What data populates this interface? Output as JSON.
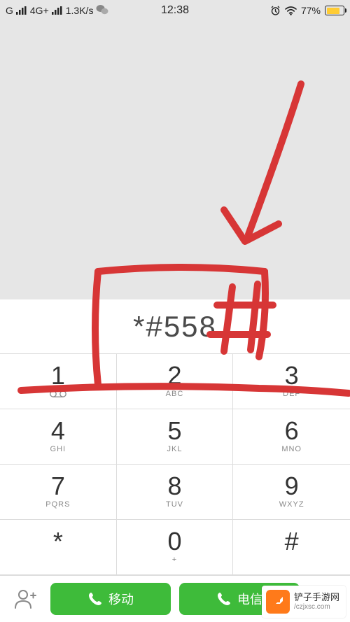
{
  "status_bar": {
    "net_label": "G",
    "net_gen": "4G+",
    "data_rate": "1.3K/s",
    "time": "12:38",
    "battery_pct": "77%",
    "battery_fill": 77
  },
  "dialer": {
    "entered_number": "*#558",
    "keys": [
      {
        "digit": "1",
        "letters": "",
        "voicemail": true
      },
      {
        "digit": "2",
        "letters": "ABC"
      },
      {
        "digit": "3",
        "letters": "DEF"
      },
      {
        "digit": "4",
        "letters": "GHI"
      },
      {
        "digit": "5",
        "letters": "JKL"
      },
      {
        "digit": "6",
        "letters": "MNO"
      },
      {
        "digit": "7",
        "letters": "PQRS"
      },
      {
        "digit": "8",
        "letters": "TUV"
      },
      {
        "digit": "9",
        "letters": "WXYZ"
      },
      {
        "digit": "*",
        "letters": ""
      },
      {
        "digit": "0",
        "letters": "+"
      },
      {
        "digit": "#",
        "letters": ""
      }
    ]
  },
  "bottom": {
    "call_sim1_label": "移动",
    "call_sim2_label": "电信"
  },
  "watermark": {
    "title": "铲子手游网",
    "url": "/czjxsc.com"
  },
  "colors": {
    "call_green": "#3ebb3a",
    "marker_red": "#d73636",
    "battery_yellow": "#ffcc33",
    "wm_orange": "#ff7a1a"
  }
}
